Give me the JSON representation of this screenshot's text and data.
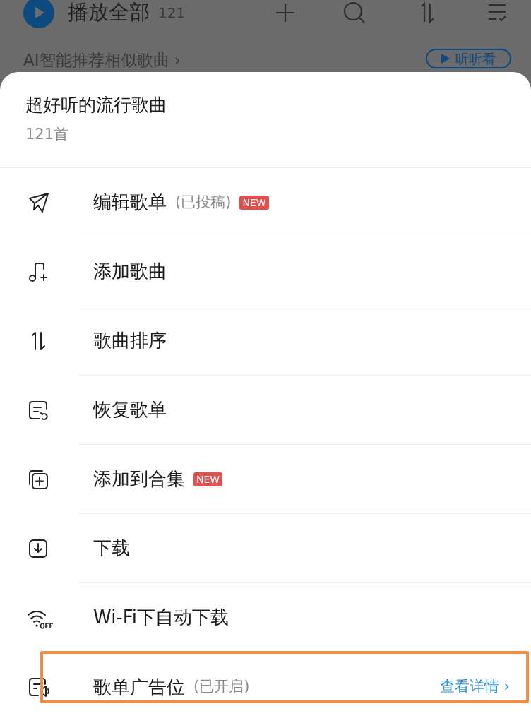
{
  "header": {
    "title": "播放全部",
    "count": "121"
  },
  "recommend": {
    "text": "AI智能推荐相似歌曲 ›",
    "button": "听听看"
  },
  "sheet": {
    "title": "超好听的流行歌曲",
    "subtitle": "121首",
    "items": [
      {
        "label": "编辑歌单",
        "note": "(已投稿)",
        "badge": "NEW",
        "highlighted": false
      },
      {
        "label": "添加歌曲",
        "highlighted": false
      },
      {
        "label": "歌曲排序",
        "highlighted": false
      },
      {
        "label": "恢复歌单",
        "highlighted": false
      },
      {
        "label": "添加到合集",
        "badge": "NEW",
        "highlighted": false
      },
      {
        "label": "下载",
        "highlighted": false
      },
      {
        "label": "Wi-Fi下自动下载",
        "highlighted": false
      },
      {
        "label": "歌单广告位",
        "note": "(已开启)",
        "link": "查看详情 ›",
        "highlighted": true
      }
    ]
  }
}
